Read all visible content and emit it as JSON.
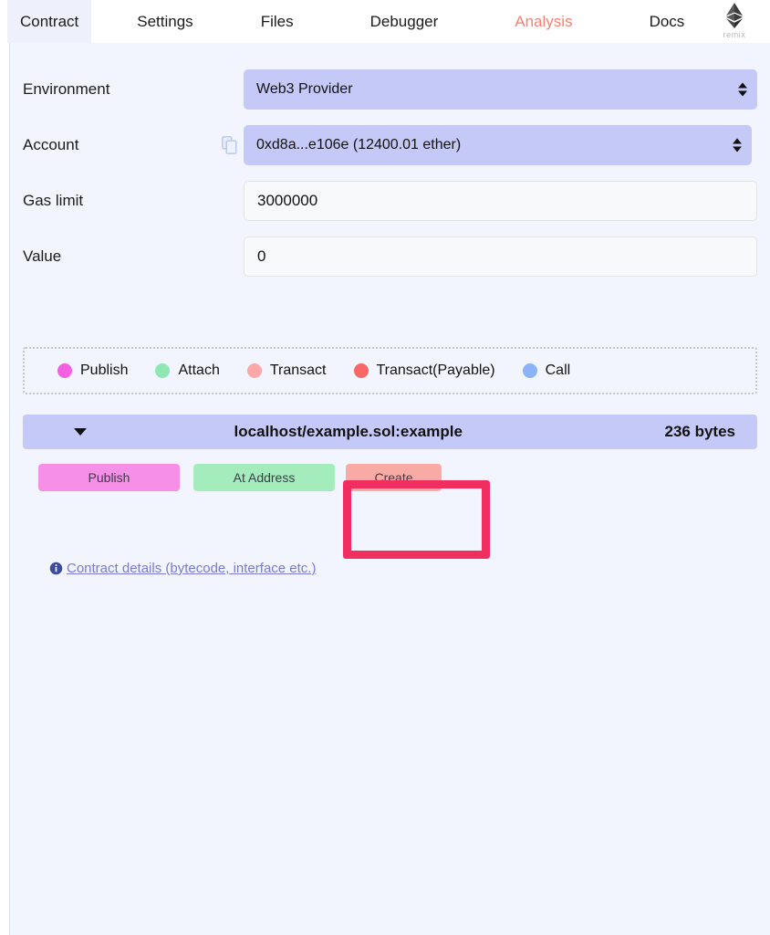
{
  "app": {
    "logo_wordmark": "remix",
    "logo_icon": "ethereum-diamond-icon"
  },
  "tabs": [
    {
      "label": "Contract",
      "active": true,
      "accent": false
    },
    {
      "label": "Settings",
      "active": false,
      "accent": false
    },
    {
      "label": "Files",
      "active": false,
      "accent": false
    },
    {
      "label": "Debugger",
      "active": false,
      "accent": false
    },
    {
      "label": "Analysis",
      "active": false,
      "accent": true
    },
    {
      "label": "Docs",
      "active": false,
      "accent": false
    }
  ],
  "form": {
    "environment": {
      "label": "Environment",
      "value": "Web3 Provider"
    },
    "account": {
      "label": "Account",
      "value": "0xd8a...e106e (12400.01 ether)",
      "copy_icon": "copy-icon"
    },
    "gas_limit": {
      "label": "Gas limit",
      "value": "3000000",
      "placeholder": "Gas limit"
    },
    "value": {
      "label": "Value",
      "value": "0",
      "placeholder": "Value"
    }
  },
  "legend": {
    "items": [
      {
        "label": "Publish",
        "color": "#f361e0"
      },
      {
        "label": "Attach",
        "color": "#8fe8b4"
      },
      {
        "label": "Transact",
        "color": "#fba8a8"
      },
      {
        "label": "Transact(Payable)",
        "color": "#fa6767"
      },
      {
        "label": "Call",
        "color": "#8ab4f8"
      }
    ]
  },
  "contract": {
    "caret_icon": "chevron-down-icon",
    "name": "localhost/example.sol:example",
    "size": "236 bytes"
  },
  "actions": {
    "publish": "Publish",
    "at_address": "At Address",
    "create": "Create"
  },
  "details": {
    "info_icon": "info-icon",
    "link_text": "Contract details (bytecode, interface etc.)"
  },
  "highlight": {
    "target": "create-button",
    "color": "#f02f60"
  }
}
